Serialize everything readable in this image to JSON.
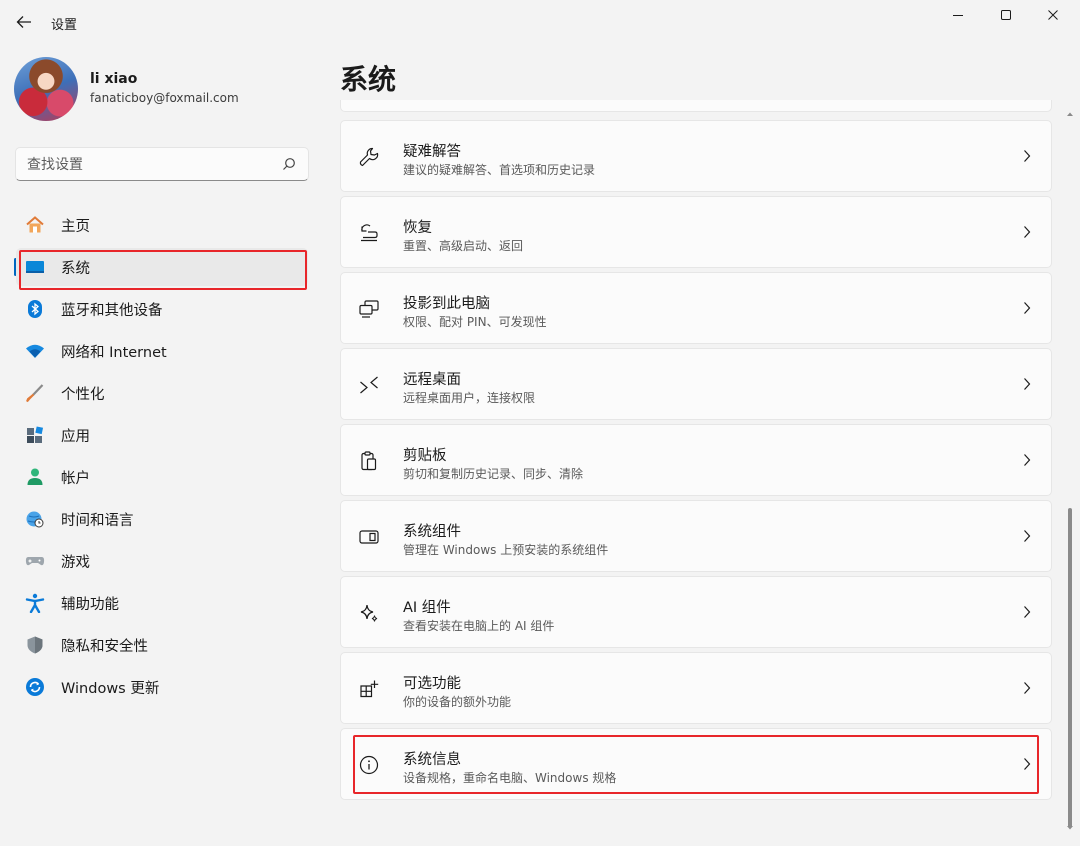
{
  "window": {
    "title": "设置",
    "controls": {
      "minimize": "minimize-icon",
      "maximize": "maximize-icon",
      "close": "close-icon"
    }
  },
  "profile": {
    "name": "li xiao",
    "email": "fanaticboy@foxmail.com"
  },
  "search": {
    "placeholder": "查找设置"
  },
  "sidebar": {
    "items": [
      {
        "label": "主页",
        "icon": "home-icon"
      },
      {
        "label": "系统",
        "icon": "system-icon",
        "active": true
      },
      {
        "label": "蓝牙和其他设备",
        "icon": "bluetooth-icon"
      },
      {
        "label": "网络和 Internet",
        "icon": "wifi-icon"
      },
      {
        "label": "个性化",
        "icon": "brush-icon"
      },
      {
        "label": "应用",
        "icon": "apps-icon"
      },
      {
        "label": "帐户",
        "icon": "account-icon"
      },
      {
        "label": "时间和语言",
        "icon": "globe-clock-icon"
      },
      {
        "label": "游戏",
        "icon": "gamepad-icon"
      },
      {
        "label": "辅助功能",
        "icon": "accessibility-icon"
      },
      {
        "label": "隐私和安全性",
        "icon": "shield-icon"
      },
      {
        "label": "Windows 更新",
        "icon": "update-icon"
      }
    ]
  },
  "main": {
    "heading": "系统",
    "cards": [
      {
        "title": "疑难解答",
        "desc": "建议的疑难解答、首选项和历史记录",
        "icon": "wrench-icon"
      },
      {
        "title": "恢复",
        "desc": "重置、高级启动、返回",
        "icon": "recovery-icon"
      },
      {
        "title": "投影到此电脑",
        "desc": "权限、配对 PIN、可发现性",
        "icon": "project-icon"
      },
      {
        "title": "远程桌面",
        "desc": "远程桌面用户，连接权限",
        "icon": "remote-desktop-icon"
      },
      {
        "title": "剪贴板",
        "desc": "剪切和复制历史记录、同步、清除",
        "icon": "clipboard-icon"
      },
      {
        "title": "系统组件",
        "desc": "管理在 Windows 上预安装的系统组件",
        "icon": "components-icon"
      },
      {
        "title": "AI 组件",
        "desc": "查看安装在电脑上的 AI 组件",
        "icon": "sparkle-icon"
      },
      {
        "title": "可选功能",
        "desc": "你的设备的额外功能",
        "icon": "optional-features-icon"
      },
      {
        "title": "系统信息",
        "desc": "设备规格，重命名电脑、Windows 规格",
        "icon": "info-icon"
      }
    ]
  },
  "colors": {
    "accent": "#0067c0",
    "highlight": "#e8262a",
    "background": "#f3f3f3",
    "card": "#fbfbfb"
  }
}
